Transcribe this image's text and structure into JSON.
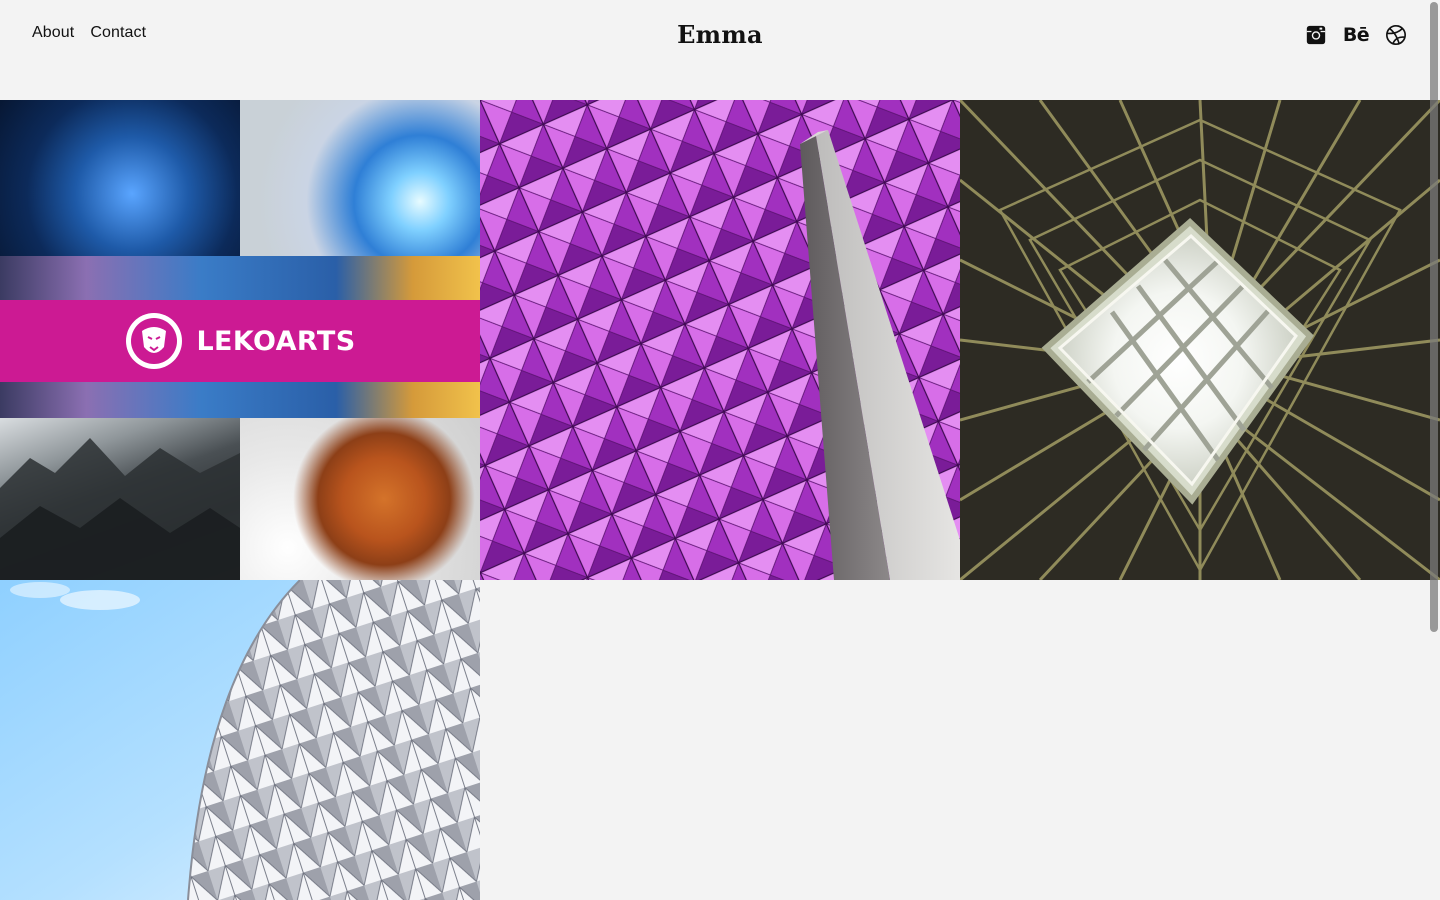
{
  "header": {
    "nav": [
      {
        "label": "About"
      },
      {
        "label": "Contact"
      }
    ],
    "brand": "Emma",
    "social": [
      {
        "icon": "instagram-icon"
      },
      {
        "icon": "behance-icon",
        "glyph": "Bē"
      },
      {
        "icon": "dribbble-icon"
      }
    ]
  },
  "projects": [
    {
      "banner_text": "LEKOARTS",
      "accent": "#cc1a93"
    },
    {
      "accent": "#d24fe6"
    },
    {
      "accent": "#6f6a3a"
    },
    {
      "accent": "#bfe3ff"
    }
  ],
  "colors": {
    "background": "#f3f3f3",
    "text": "#111111",
    "magenta": "#cc1a93"
  }
}
